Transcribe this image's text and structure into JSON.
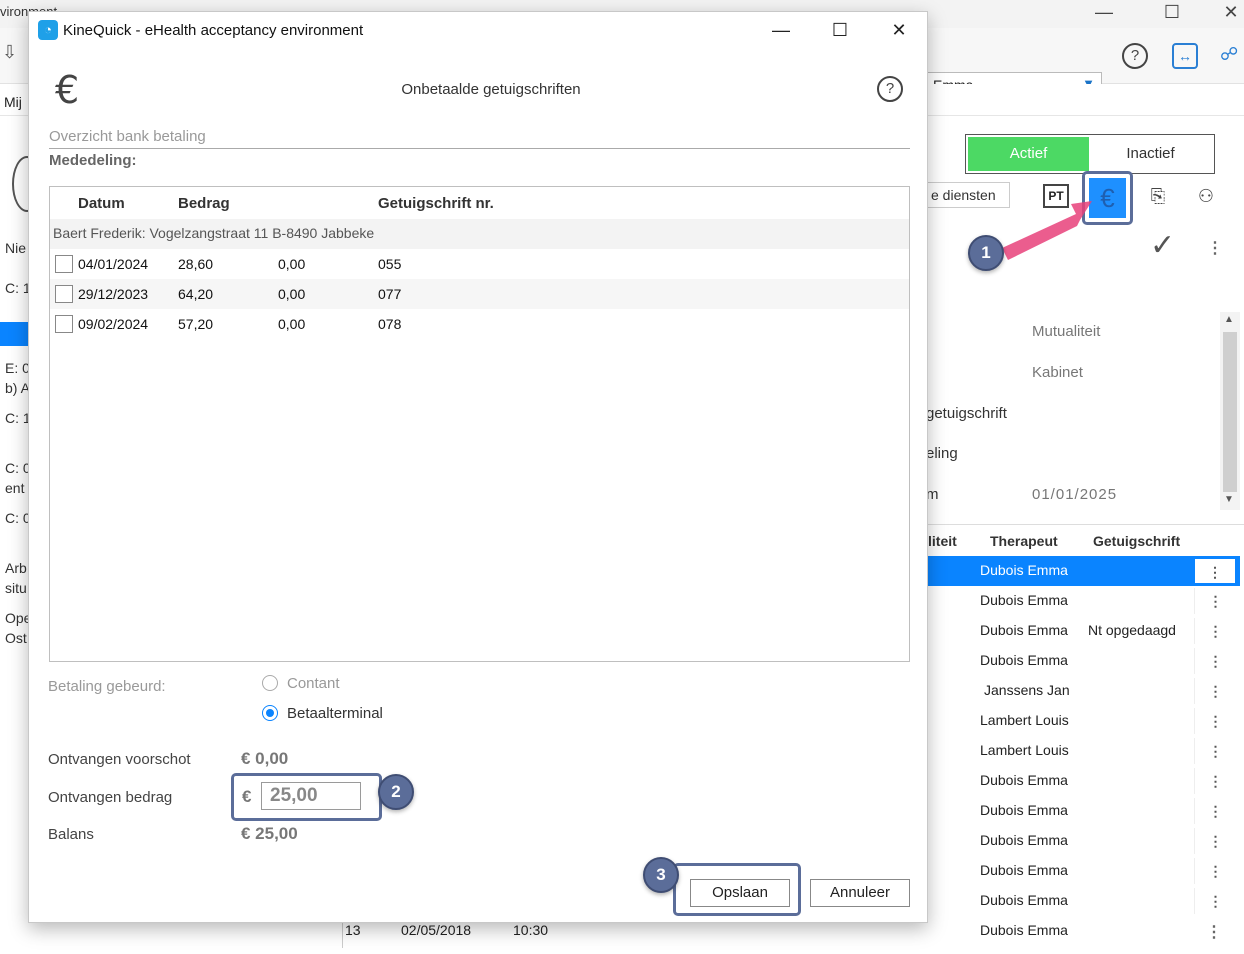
{
  "background": {
    "title_fragment": "vironment",
    "doctor_select": "Emma",
    "mijn_fragment": "Mij",
    "status": {
      "active": "Actief",
      "inactive": "Inactief"
    },
    "diensten_button": "e diensten",
    "pt_label": "PT",
    "left_fragments": [
      "Nie",
      "C: 1",
      "E: 0",
      "b) A",
      "C: 1",
      "C: 0",
      "ent",
      "C: 0",
      "Arb",
      "situ",
      "Ope",
      "Ost"
    ],
    "details": {
      "mutualiteit": "Mutualiteit",
      "kabinet": "Kabinet",
      "getuigschrift": "getuigschrift",
      "mededeling_frag": "eling",
      "datum_frag": "m",
      "date": "01/01/2025"
    },
    "grid": {
      "headers": [
        "liteit",
        "Therapeut",
        "Getuigschrift"
      ],
      "rows": [
        {
          "therapeut": "Dubois Emma",
          "getuigschrift": ""
        },
        {
          "therapeut": "Dubois Emma",
          "getuigschrift": ""
        },
        {
          "therapeut": "Dubois Emma",
          "getuigschrift": "Nt opgedaagd"
        },
        {
          "therapeut": "Dubois Emma",
          "getuigschrift": ""
        },
        {
          "therapeut": "Janssens Jan",
          "getuigschrift": ""
        },
        {
          "therapeut": "Lambert Louis",
          "getuigschrift": ""
        },
        {
          "therapeut": "Lambert Louis",
          "getuigschrift": ""
        },
        {
          "therapeut": "Dubois Emma",
          "getuigschrift": ""
        },
        {
          "therapeut": "Dubois Emma",
          "getuigschrift": ""
        },
        {
          "therapeut": "Dubois Emma",
          "getuigschrift": ""
        },
        {
          "therapeut": "Dubois Emma",
          "getuigschrift": ""
        },
        {
          "therapeut": "Dubois Emma",
          "getuigschrift": ""
        }
      ],
      "bottom_row": {
        "nr": "13",
        "date": "02/05/2018",
        "time": "10:30",
        "therapeut": "Dubois Emma"
      }
    }
  },
  "dialog": {
    "window_title": "KineQuick - eHealth acceptancy environment",
    "heading": "Onbetaalde getuigschriften",
    "overview_label": "Overzicht bank betaling",
    "mededeling_label": "Mededeling:",
    "table": {
      "headers": {
        "datum": "Datum",
        "bedrag": "Bedrag",
        "nr": "Getuigschrift nr."
      },
      "group": "Baert Frederik: Vogelzangstraat 11 B-8490 Jabbeke",
      "rows": [
        {
          "datum": "04/01/2024",
          "bedrag": "28,60",
          "betaald": "0,00",
          "nr": "055"
        },
        {
          "datum": "29/12/2023",
          "bedrag": "64,20",
          "betaald": "0,00",
          "nr": "077"
        },
        {
          "datum": "09/02/2024",
          "bedrag": "57,20",
          "betaald": "0,00",
          "nr": "078"
        }
      ]
    },
    "payment": {
      "label": "Betaling gebeurd:",
      "options": [
        "Contant",
        "Betaalterminal"
      ],
      "selected": "Betaalterminal"
    },
    "summary": {
      "voorschot_label": "Ontvangen voorschot",
      "voorschot_value": "€ 0,00",
      "bedrag_label": "Ontvangen bedrag",
      "currency": "€",
      "bedrag_value": "25,00",
      "balans_label": "Balans",
      "balans_value": "€ 25,00"
    },
    "buttons": {
      "save": "Opslaan",
      "cancel": "Annuleer"
    }
  },
  "annotations": {
    "badge1": "1",
    "badge2": "2",
    "badge3": "3"
  },
  "colors": {
    "accent_blue": "#0a84ff",
    "active_green": "#4cd964",
    "annotation": "#5b6d99",
    "arrow_pink": "#e8417a"
  }
}
